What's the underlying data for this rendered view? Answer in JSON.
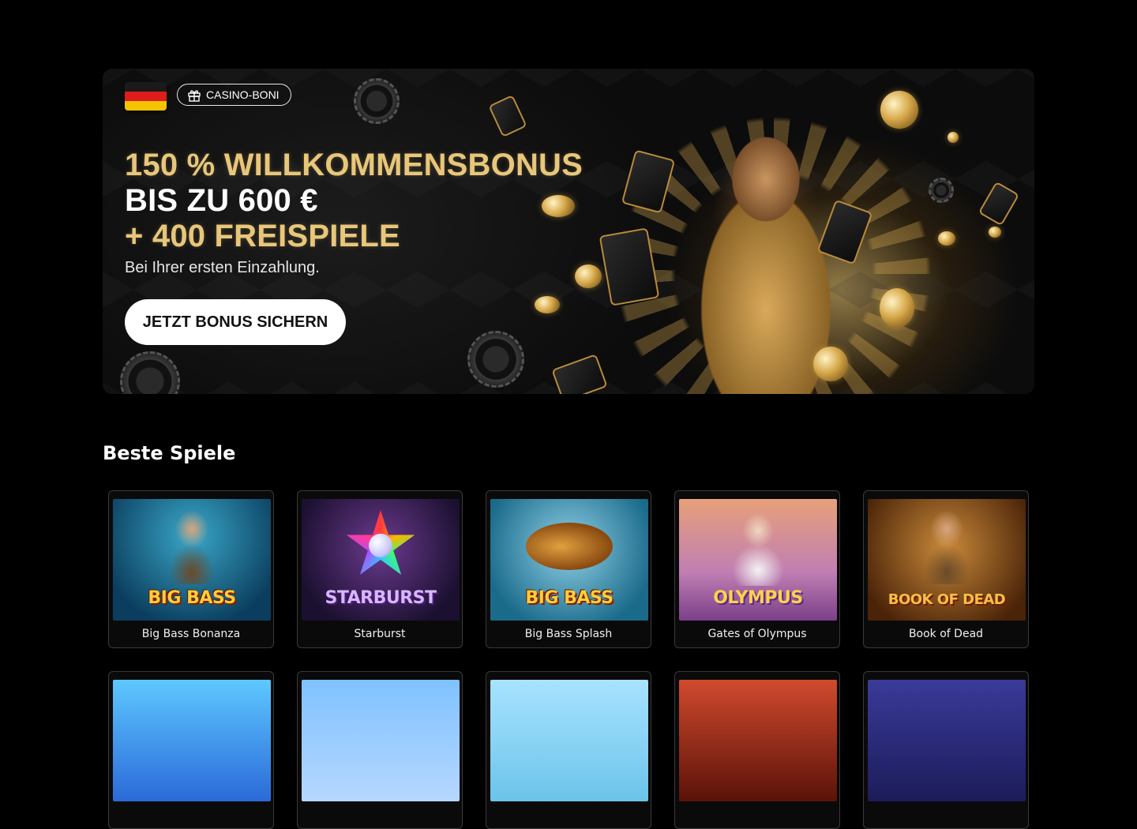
{
  "banner": {
    "country_flag": "germany-flag",
    "badge_label": "CASINO-BONI",
    "headline_line1": "150 % WILLKOMMENSBONUS",
    "headline_line2": "BIS ZU 600 €",
    "headline_line3": "+ 400 FREISPIELE",
    "subtext": "Bei Ihrer ersten Einzahlung.",
    "cta_label": "JETZT BONUS SICHERN",
    "colors": {
      "gold": "#e8c67a",
      "background": "#0b0b0b",
      "cta_bg": "#ffffff"
    }
  },
  "games_section": {
    "title": "Beste Spiele",
    "games": [
      {
        "title": "Big Bass Bonanza",
        "logo": "BIG BASS"
      },
      {
        "title": "Starburst",
        "logo": "STARBURST"
      },
      {
        "title": "Big Bass Splash",
        "logo": "BIG BASS"
      },
      {
        "title": "Gates of Olympus",
        "logo": "OLYMPUS"
      },
      {
        "title": "Book of Dead",
        "logo": "BOOK OF DEAD"
      },
      {
        "title": ""
      },
      {
        "title": ""
      },
      {
        "title": ""
      },
      {
        "title": ""
      },
      {
        "title": ""
      }
    ]
  }
}
